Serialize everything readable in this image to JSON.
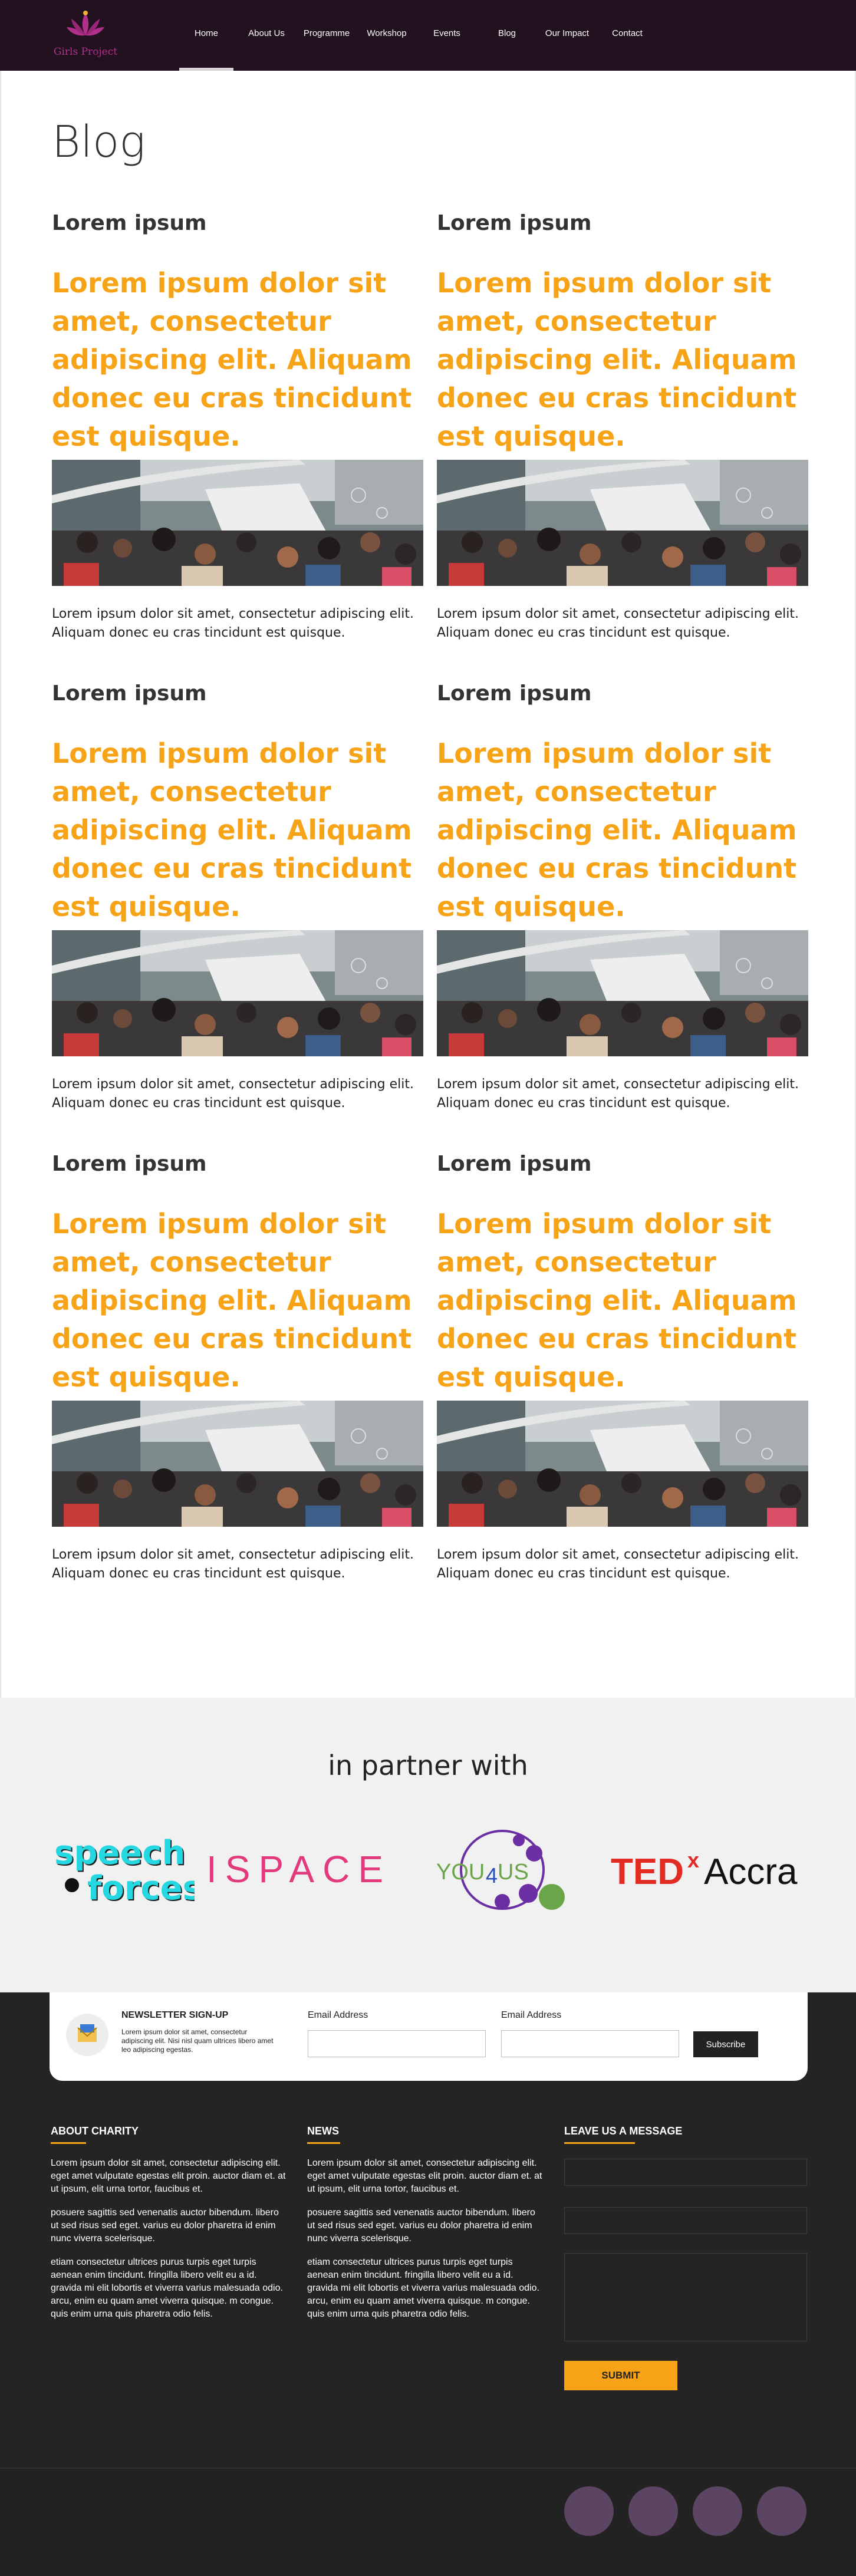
{
  "brand": {
    "logo_text": "Girls Project"
  },
  "nav": {
    "items": [
      {
        "label": "Home",
        "active": true
      },
      {
        "label": "About Us",
        "active": false
      },
      {
        "label": "Programme",
        "active": false
      },
      {
        "label": "Workshop",
        "active": false
      },
      {
        "label": "Events",
        "active": false
      },
      {
        "label": "Blog",
        "active": false
      },
      {
        "label": "Our Impact",
        "active": false
      },
      {
        "label": "Contact",
        "active": false
      }
    ]
  },
  "page": {
    "title": "Blog"
  },
  "posts": [
    {
      "title": "Lorem ipsum",
      "headline": "Lorem ipsum dolor sit amet, consectetur adipiscing elit. Aliquam donec eu cras tincidunt est quisque.",
      "text": "Lorem ipsum dolor sit amet, consectetur adipiscing elit. Aliquam donec eu cras tincidunt est quisque."
    },
    {
      "title": "Lorem ipsum",
      "headline": "Lorem ipsum dolor sit amet, consectetur adipiscing elit. Aliquam donec eu cras tincidunt est quisque.",
      "text": "Lorem ipsum dolor sit amet, consectetur adipiscing elit. Aliquam donec eu cras tincidunt est quisque."
    },
    {
      "title": "Lorem ipsum",
      "headline": "Lorem ipsum dolor sit amet, consectetur adipiscing elit. Aliquam donec eu cras tincidunt est quisque.",
      "text": "Lorem ipsum dolor sit amet, consectetur adipiscing elit. Aliquam donec eu cras tincidunt est quisque."
    },
    {
      "title": "Lorem ipsum",
      "headline": "Lorem ipsum dolor sit amet, consectetur adipiscing elit. Aliquam donec eu cras tincidunt est quisque.",
      "text": "Lorem ipsum dolor sit amet, consectetur adipiscing elit. Aliquam donec eu cras tincidunt est quisque."
    },
    {
      "title": "Lorem ipsum",
      "headline": "Lorem ipsum dolor sit amet, consectetur adipiscing elit. Aliquam donec eu cras tincidunt est quisque.",
      "text": "Lorem ipsum dolor sit amet, consectetur adipiscing elit. Aliquam donec eu cras tincidunt est quisque."
    },
    {
      "title": "Lorem ipsum",
      "headline": "Lorem ipsum dolor sit amet, consectetur adipiscing elit. Aliquam donec eu cras tincidunt est quisque.",
      "text": "Lorem ipsum dolor sit amet, consectetur adipiscing elit. Aliquam donec eu cras tincidunt est quisque."
    }
  ],
  "partners": {
    "title": "in partner with",
    "logos": {
      "speech_line1": "speech",
      "speech_line2": "forces",
      "ispace": "ISPACE",
      "you4us_a": "YOU",
      "you4us_b": "4",
      "you4us_c": "US",
      "tedx_ted": "TED",
      "tedx_x": "x",
      "tedx_city": "Accra"
    }
  },
  "newsletter": {
    "title": "NEWSLETTER SIGN-UP",
    "description": "Lorem ipsum dolor sit amet, consectetur adipiscing elit. Nisi nisl quam ultrices libero amet leo adipiscing egestas.",
    "field1_label": "Email Address",
    "field2_label": "Email Address",
    "button": "Subscribe"
  },
  "footer": {
    "about": {
      "heading": "ABOUT CHARITY",
      "paragraphs": [
        "Lorem ipsum dolor sit amet, consectetur adipiscing elit. eget amet vulputate egestas elit proin. auctor diam et. at ut ipsum, elit urna tortor, faucibus et.",
        "posuere sagittis sed venenatis auctor bibendum. libero ut sed risus sed eget. varius eu dolor pharetra id enim nunc viverra scelerisque.",
        "etiam consectetur ultrices purus turpis eget turpis aenean enim tincidunt. fringilla libero velit eu a id. gravida mi elit lobortis et viverra varius malesuada odio. arcu, enim eu quam amet viverra quisque. m congue. quis enim urna quis pharetra odio felis."
      ]
    },
    "news": {
      "heading": "NEWS",
      "paragraphs": [
        "Lorem ipsum dolor sit amet, consectetur adipiscing elit. eget amet vulputate egestas elit proin. auctor diam et. at ut ipsum, elit urna tortor, faucibus et.",
        "posuere sagittis sed venenatis auctor bibendum. libero ut sed risus sed eget. varius eu dolor pharetra id enim nunc viverra scelerisque.",
        "etiam consectetur ultrices purus turpis eget turpis aenean enim tincidunt. fringilla libero velit eu a id. gravida mi elit lobortis et viverra varius malesuada odio. arcu, enim eu quam amet viverra quisque. m congue. quis enim urna quis pharetra odio felis."
      ]
    },
    "message": {
      "heading": "LEAVE US A MESSAGE",
      "submit": "SUBMIT"
    },
    "social_icons": [
      "facebook-icon",
      "twitter-icon",
      "instagram-icon",
      "linkedin-icon"
    ]
  },
  "colors": {
    "nav_bg": "#22111e",
    "accent_orange": "#f7a318",
    "footer_bg": "#242424",
    "social_circle": "#5c4563"
  }
}
